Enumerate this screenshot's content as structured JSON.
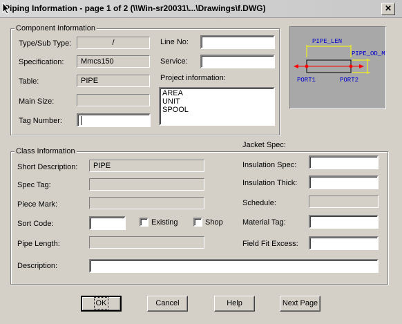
{
  "window": {
    "title": "Piping Information - page 1 of 2 (\\\\Win-sr20031\\...\\Drawings\\f.DWG)",
    "close_label": "✕"
  },
  "component": {
    "group_title": "Component Information",
    "type_label": "Type/Sub Type:",
    "type_value": "/",
    "spec_label": "Specification:",
    "spec_value": "Mmcs150",
    "table_label": "Table:",
    "table_value": "PIPE",
    "main_size_label": "Main Size:",
    "main_size_value": "",
    "tag_label": "Tag Number:",
    "tag_value": "",
    "line_no_label": "Line No:",
    "line_no_value": "",
    "service_label": "Service:",
    "service_value": "",
    "project_label": "Project information:",
    "project_items": [
      "AREA",
      "UNIT",
      "SPOOL"
    ]
  },
  "preview": {
    "pipe_len": "PIPE_LEN",
    "pipe_od": "PIPE_OD_M",
    "port1": "PORT1",
    "port2": "PORT2"
  },
  "class_info": {
    "group_title": "Class Information",
    "short_desc_label": "Short Description:",
    "short_desc_value": "PIPE",
    "spec_tag_label": "Spec Tag:",
    "spec_tag_value": "",
    "piece_mark_label": "Piece Mark:",
    "piece_mark_value": "",
    "sort_code_label": "Sort Code:",
    "sort_code_value": "",
    "existing_label": "Existing",
    "shop_label": "Shop",
    "pipe_length_label": "Pipe Length:",
    "pipe_length_value": "",
    "description_label": "Description:",
    "description_value": "",
    "jacket_label": "Jacket Spec:",
    "ins_spec_label": "Insulation Spec:",
    "ins_spec_value": "",
    "ins_thick_label": "Insulation Thick:",
    "ins_thick_value": "",
    "schedule_label": "Schedule:",
    "schedule_value": "",
    "material_label": "Material Tag:",
    "material_value": "",
    "field_fit_label": "Field Fit Excess:",
    "field_fit_value": ""
  },
  "buttons": {
    "ok": "OK",
    "cancel": "Cancel",
    "help": "Help",
    "next": "Next Page"
  },
  "colors": {
    "preview_bg": "#a8a8a8",
    "dim_line": "#ffff00",
    "dim_text": "#0000cc",
    "port": "#ff0000"
  }
}
